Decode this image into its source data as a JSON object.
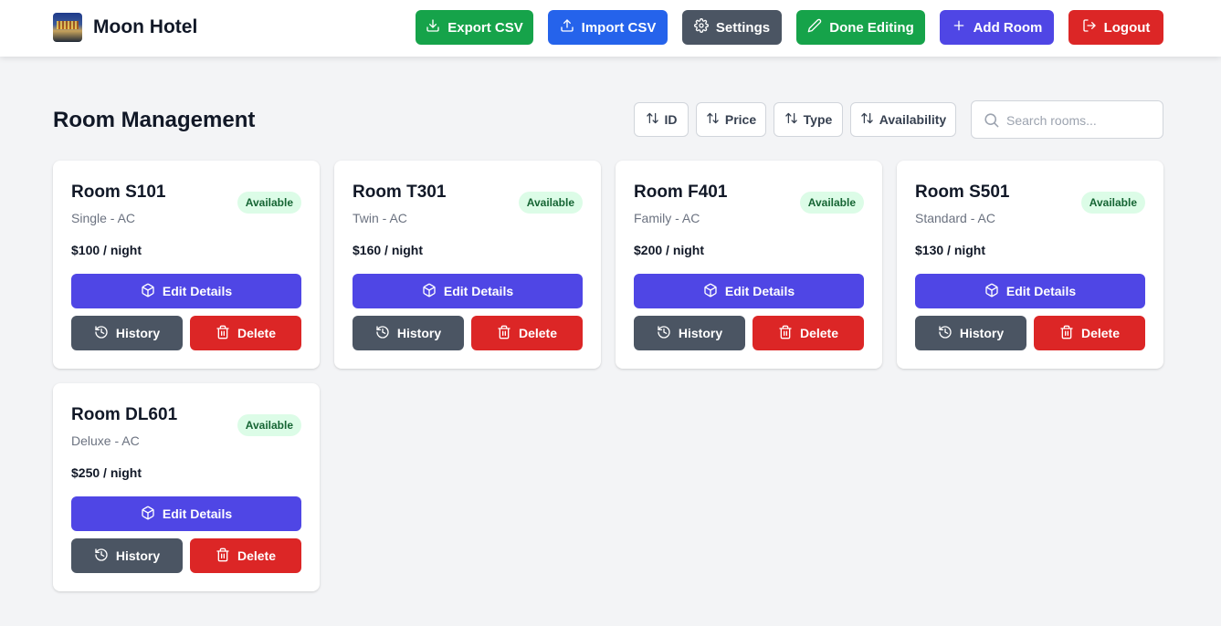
{
  "app": {
    "name": "Moon Hotel"
  },
  "header": {
    "buttons": {
      "export": "Export CSV",
      "import": "Import CSV",
      "settings": "Settings",
      "done": "Done Editing",
      "add": "Add Room",
      "logout": "Logout"
    }
  },
  "main": {
    "title": "Room Management",
    "sort": {
      "id": "ID",
      "price": "Price",
      "type": "Type",
      "availability": "Availability"
    },
    "search": {
      "placeholder": "Search rooms...",
      "value": ""
    }
  },
  "card_actions": {
    "edit": "Edit Details",
    "history": "History",
    "delete": "Delete"
  },
  "rooms": [
    {
      "name": "Room S101",
      "type": "Single - AC",
      "price": "$100 / night",
      "status": "Available"
    },
    {
      "name": "Room T301",
      "type": "Twin - AC",
      "price": "$160 / night",
      "status": "Available"
    },
    {
      "name": "Room F401",
      "type": "Family - AC",
      "price": "$200 / night",
      "status": "Available"
    },
    {
      "name": "Room S501",
      "type": "Standard - AC",
      "price": "$130 / night",
      "status": "Available"
    },
    {
      "name": "Room DL601",
      "type": "Deluxe - AC",
      "price": "$250 / night",
      "status": "Available"
    }
  ],
  "colors": {
    "export": "#16a34a",
    "import": "#2563eb",
    "settings": "#4b5563",
    "done": "#16a34a",
    "add": "#4f46e5",
    "logout": "#dc2626",
    "available_bg": "#dcfce7",
    "available_text": "#166534"
  }
}
